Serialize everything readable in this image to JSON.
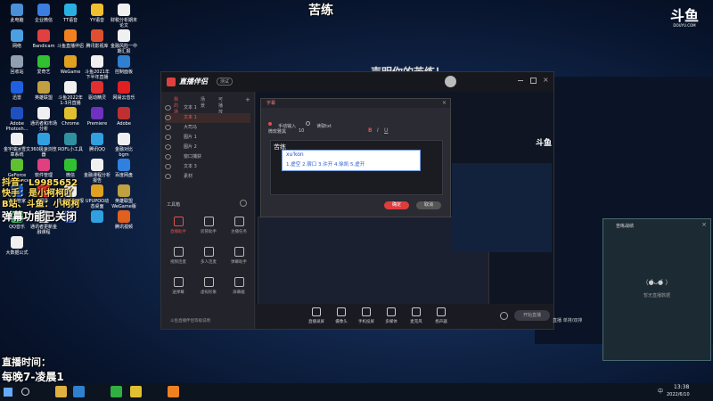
{
  "overlay": {
    "title": "苦练",
    "douyu_logo": "斗鱼",
    "douyu_sub": "DOUYU.COM",
    "line1": "抖音：L9985652",
    "line2": "快手：是小柯柯吖",
    "line3": "B站、斗鱼：小柯柯",
    "line4": "弹幕功能已关闭",
    "line5": "直播时间：",
    "line6": "每晚7-凌晨1"
  },
  "desktop_icons": [
    {
      "label": "此电脑",
      "color": "#4a90d9"
    },
    {
      "label": "企业微信",
      "color": "#3b7de0"
    },
    {
      "label": "TT语音",
      "color": "#2ab0e0"
    },
    {
      "label": "YY语音",
      "color": "#f0c030"
    },
    {
      "label": "财税分析期末论文",
      "color": "#f0f0f0"
    },
    {
      "label": "网络",
      "color": "#4aa0e0"
    },
    {
      "label": "Bandicam",
      "color": "#e04040"
    },
    {
      "label": "斗鱼直播伴侣",
      "color": "#f08020"
    },
    {
      "label": "腾讯影视库",
      "color": "#e05030"
    },
    {
      "label": "金融风险一中期汇报",
      "color": "#f0f0f0"
    },
    {
      "label": "回收站",
      "color": "#90a0b0"
    },
    {
      "label": "爱奇艺",
      "color": "#30c030"
    },
    {
      "label": "WeGame",
      "color": "#e0a020"
    },
    {
      "label": "斗鱼2021年下半年直播",
      "color": "#f0f0f0"
    },
    {
      "label": "控制面板",
      "color": "#3080d0"
    },
    {
      "label": "迅雷",
      "color": "#2060e0"
    },
    {
      "label": "英雄联盟",
      "color": "#c0a040"
    },
    {
      "label": "斗鱼2022年1-3月直播",
      "color": "#f0f0f0"
    },
    {
      "label": "驱动精灵",
      "color": "#e03030"
    },
    {
      "label": "网易云音乐",
      "color": "#e02020"
    },
    {
      "label": "Adobe Photosh...",
      "color": "#2050c0"
    },
    {
      "label": "通讯者和市场分析",
      "color": "#f0f0f0"
    },
    {
      "label": "Chrome",
      "color": "#e0c030"
    },
    {
      "label": "Premiere",
      "color": "#7030c0"
    },
    {
      "label": "Adobe",
      "color": "#c03030"
    },
    {
      "label": "金宇瑞冰雪文章系统",
      "color": "#f0f0f0"
    },
    {
      "label": "360极速浏览器",
      "color": "#30a0e0"
    },
    {
      "label": "ROFL小工具",
      "color": "#3090a0"
    },
    {
      "label": "腾讯QQ",
      "color": "#30a0e0"
    },
    {
      "label": "金融对比bgm",
      "color": "#f0f0f0"
    },
    {
      "label": "GeForce Experience",
      "color": "#60c030"
    },
    {
      "label": "软件管理",
      "color": "#e04080"
    },
    {
      "label": "微信",
      "color": "#30c030"
    },
    {
      "label": "金融课程分析报告",
      "color": "#f0f0f0"
    },
    {
      "label": "百度网盘",
      "color": "#3080e0"
    },
    {
      "label": "电脑管家",
      "color": "#2060d0"
    },
    {
      "label": "网易",
      "color": "#e03030"
    },
    {
      "label": "通讯者更新报告",
      "color": "#f0f0f0"
    },
    {
      "label": "UPUPOO动态桌面",
      "color": "#e0a020"
    },
    {
      "label": "英雄联盟WeGame版",
      "color": "#c0a040"
    },
    {
      "label": "QQ音乐",
      "color": "#30c060"
    },
    {
      "label": "通讯者更新金融课程",
      "color": "#f0f0f0"
    },
    {
      "label": "",
      "color": "#4060c0"
    },
    {
      "label": "",
      "color": "#30a0e0"
    },
    {
      "label": "腾讯视频",
      "color": "#e06020"
    },
    {
      "label": "大数据公式",
      "color": "#f0f0f0"
    }
  ],
  "app": {
    "logo_text": "直播伴侣",
    "version": "测试",
    "stream_title_bg": "声明你的苦练！",
    "tabs": [
      "我的场景",
      "场景",
      "可播放"
    ],
    "sources": [
      {
        "label": "文本 1",
        "selected": false
      },
      {
        "label": "文本 1",
        "selected": true
      },
      {
        "label": "大司马",
        "selected": false
      },
      {
        "label": "图片 1",
        "selected": false
      },
      {
        "label": "图片 2",
        "selected": false
      },
      {
        "label": "窗口捕获",
        "selected": false
      },
      {
        "label": "文本 3",
        "selected": false
      },
      {
        "label": "素材",
        "selected": false
      }
    ],
    "toolbox_label": "工具箱",
    "tools": [
      {
        "label": "直播助手",
        "red": true
      },
      {
        "label": "房管助手",
        "red": false
      },
      {
        "label": "主播任务",
        "red": false
      },
      {
        "label": "视频连麦",
        "red": false
      },
      {
        "label": "多人连麦",
        "red": false
      },
      {
        "label": "弹幕助手",
        "red": false
      },
      {
        "label": "送弹幕",
        "red": false
      },
      {
        "label": "虚拟形象",
        "red": false
      },
      {
        "label": "屏幕截",
        "red": false
      }
    ],
    "footer_note": "斗鱼直播伴侣等级说明",
    "bottom_buttons": [
      "直播录屏",
      "摄像头",
      "手机投屏",
      "多媒体",
      "麦克风",
      "扬声器"
    ],
    "start_button": "开始直播",
    "side_note": "直播 单排/双排"
  },
  "dialog": {
    "title": "字幕",
    "radio1": "手动输入",
    "radio2": "读取txt",
    "font_name": "微软雅黑",
    "font_size": "10",
    "editor_text": "苦练",
    "confirm": "确定",
    "cancel": "取消"
  },
  "ime": {
    "pinyin": "xu'kon",
    "candidates": "1.虚空  2.宿口  3.许开  4.徐凯  5.虚开"
  },
  "preview_logo": "斗鱼",
  "right_panel": {
    "title": "苦练战绩",
    "face": "（●̀ᴗ●́ ）",
    "note": "暂无直播数据"
  },
  "taskbar": {
    "time": "13:38",
    "date": "2022/6/10",
    "lang": "中"
  }
}
